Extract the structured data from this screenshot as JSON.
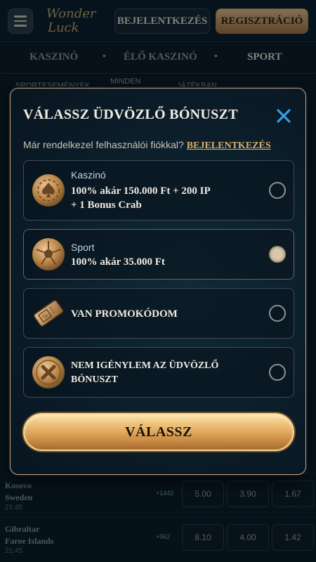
{
  "header": {
    "logo_line1": "Wonder",
    "logo_line2": "Luck",
    "login_label": "BEJELENTKEZÉS",
    "register_label": "REGISZTRÁCIÓ"
  },
  "topnav": {
    "items": [
      "KASZINÓ",
      "ÉLŐ KASZINÓ",
      "SPORT"
    ]
  },
  "subnav": {
    "items": [
      "SPORTESEMÉNYEK",
      "MINDEN",
      "JÁTÉKBAN"
    ]
  },
  "background_rows": [
    {
      "team1": "Kosovo",
      "team2": "Sweden",
      "time": "21:45",
      "stat": "+1442",
      "odds": [
        "5.00",
        "3.90",
        "1.67"
      ]
    },
    {
      "team1": "Gibraltar",
      "team2": "Faroe Islands",
      "time": "21:45",
      "stat": "+962",
      "odds": [
        "8.10",
        "4.00",
        "1.42"
      ]
    }
  ],
  "modal": {
    "title": "VÁLASSZ ÜDVÖZLŐ BÓNUSZT",
    "existing_text": "Már rendelkezel felhasználói fiókkal?",
    "existing_link": "BEJELENTKEZÉS",
    "options": [
      {
        "category": "Kaszinó",
        "desc_line1": "100% akár 150.000 Ft + 200 IP",
        "desc_line2": "+ 1 Bonus Crab",
        "selected": false,
        "icon": "casino-chip-icon"
      },
      {
        "category": "Sport",
        "desc_line1": "100% akár 35.000 Ft",
        "selected": true,
        "icon": "sport-ball-icon"
      },
      {
        "desc_line1": "VAN PROMOKÓDOM",
        "selected": false,
        "icon": "promo-ticket-icon"
      },
      {
        "desc_line1": "NEM IGÉNYLEM AZ ÜDVÖZLŐ",
        "desc_line2": "BÓNUSZT",
        "selected": false,
        "icon": "decline-x-icon"
      }
    ],
    "choose_label": "VÁLASSZ"
  },
  "colors": {
    "accent_gold": "#d9b06e",
    "background": "#0a1a26",
    "close_blue": "#3a9be0"
  }
}
